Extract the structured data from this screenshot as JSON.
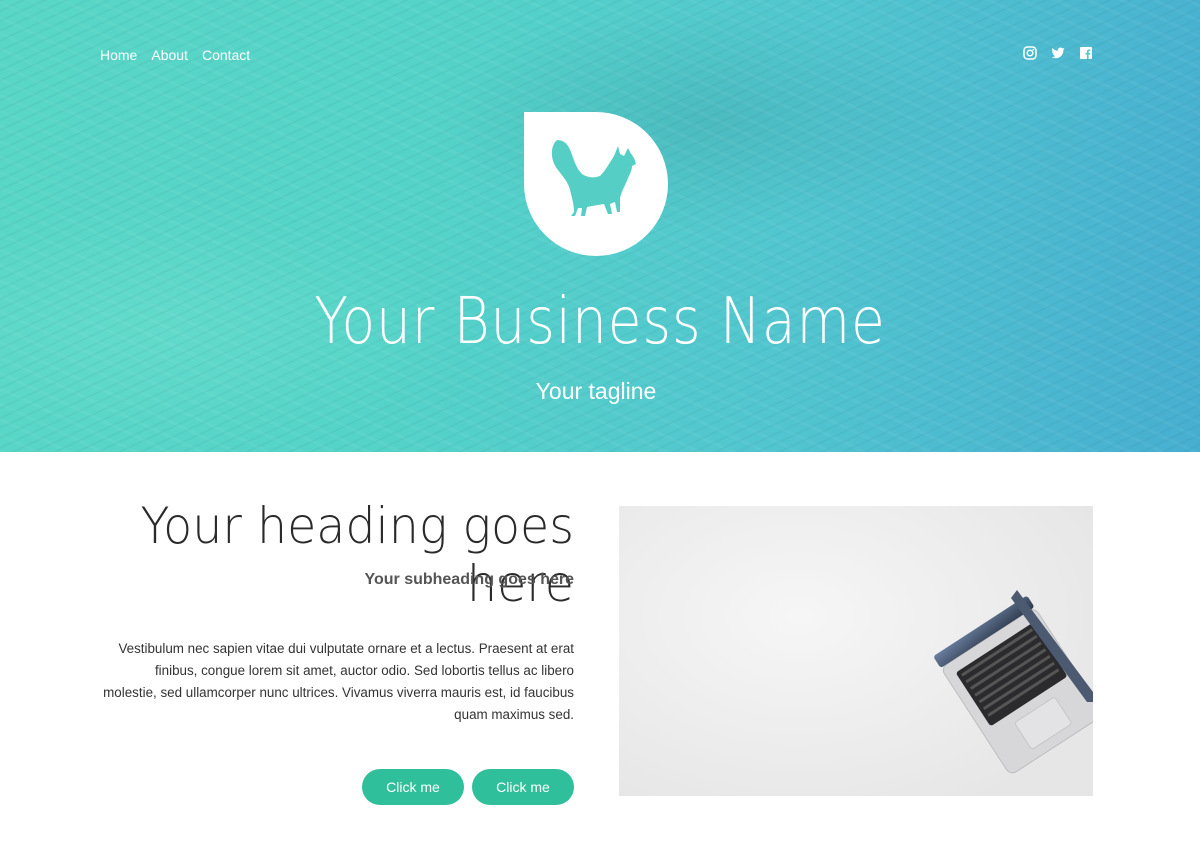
{
  "nav": {
    "home": "Home",
    "about": "About",
    "contact": "Contact"
  },
  "social": [
    "instagram-icon",
    "twitter-icon",
    "facebook-icon"
  ],
  "hero": {
    "business_name": "Your Business Name",
    "tagline": "Your tagline",
    "logo": "fox-logo-icon"
  },
  "content": {
    "heading": "Your heading goes here",
    "subheading": "Your subheading goes here",
    "body": "Vestibulum nec sapien vitae dui vulputate ornare et a lectus. Praesent at erat finibus, congue lorem sit amet, auctor odio. Sed lobortis tellus ac libero molestie, sed ullamcorper nunc ultrices. Vivamus viverra mauris est, id faucibus quam maximus sed.",
    "button1": "Click me",
    "button2": "Click me"
  },
  "colors": {
    "hero_teal": "#55d3c8",
    "button_green": "#2fbf9a"
  }
}
